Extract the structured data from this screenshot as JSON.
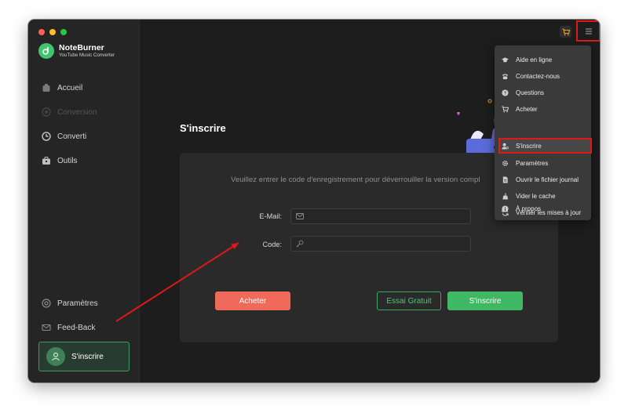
{
  "app": {
    "name": "NoteBurner",
    "subtitle": "YouTube Music Converter"
  },
  "sidebar": {
    "items": [
      {
        "label": "Accueil",
        "icon": "home-icon",
        "disabled": false
      },
      {
        "label": "Conversion",
        "icon": "conversion-icon",
        "disabled": true
      },
      {
        "label": "Converti",
        "icon": "clock-icon",
        "disabled": false
      },
      {
        "label": "Outils",
        "icon": "toolbox-icon",
        "disabled": false
      }
    ],
    "bottom": {
      "settings_label": "Paramètres",
      "feedback_label": "Feed-Back",
      "register_label": "S'inscrire"
    }
  },
  "main": {
    "title": "S'inscrire",
    "description": "Veuillez entrer le code d'enregistrement pour déverrouiller la version compl",
    "email_label": "E-Mail:",
    "code_label": "Code:",
    "email_value": "",
    "code_value": "",
    "buy_label": "Acheter",
    "trial_label": "Essai Gratuit",
    "register_label": "S'inscrire"
  },
  "menu": {
    "items": [
      {
        "label": "Aide en ligne",
        "icon": "graduation-cap-icon"
      },
      {
        "label": "Contactez-nous",
        "icon": "phone-icon"
      },
      {
        "label": "Questions",
        "icon": "question-icon"
      },
      {
        "label": "Acheter",
        "icon": "cart-icon"
      },
      {
        "label": "S'inscrire",
        "icon": "user-key-icon",
        "highlighted": true
      },
      {
        "label": "Paramètres",
        "icon": "gear-icon"
      },
      {
        "label": "Ouvrir le fichier journal",
        "icon": "file-icon"
      },
      {
        "label": "Vider le cache",
        "icon": "broom-icon"
      },
      {
        "label": "Vérifier les mises à jour",
        "icon": "refresh-icon"
      },
      {
        "label": "À propos",
        "icon": "info-icon"
      }
    ]
  },
  "colors": {
    "accent_green": "#3fb763",
    "buy_red": "#ef6a5b",
    "highlight_red": "#e01818"
  }
}
